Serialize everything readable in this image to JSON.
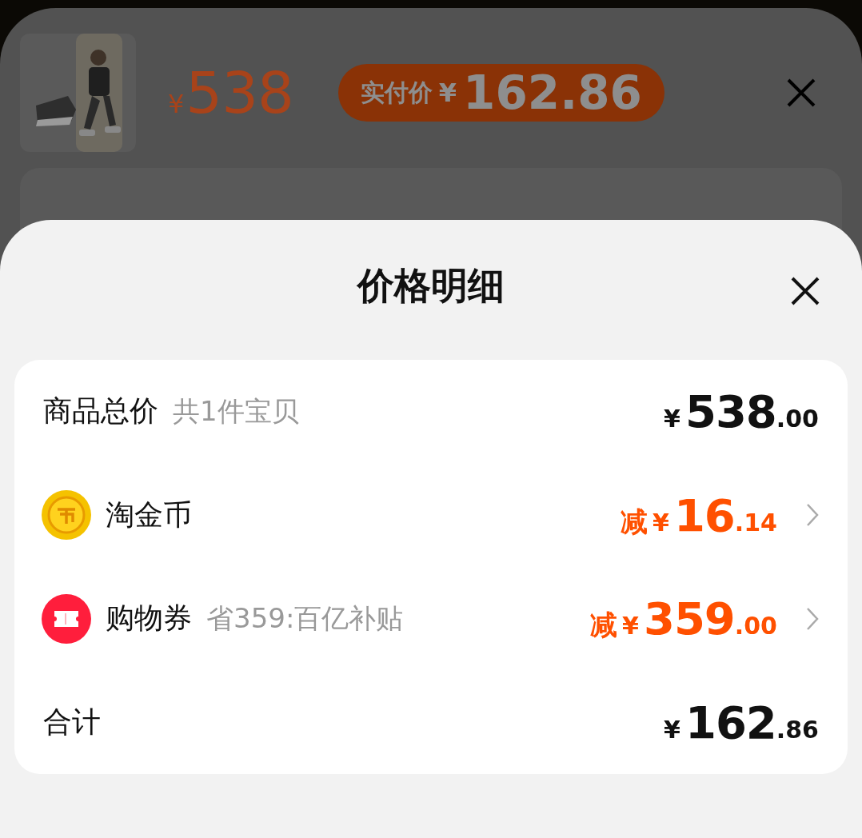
{
  "product_sheet": {
    "price": {
      "currency": "¥",
      "value": "538"
    },
    "paid_badge": {
      "label": "实付价",
      "currency": "¥",
      "value": "162.86"
    }
  },
  "price_detail": {
    "title": "价格明细",
    "rows": [
      {
        "kind": "subtotal",
        "label": "商品总价",
        "note": "共1件宝贝",
        "amount": {
          "currency": "¥",
          "integer": "538",
          "decimal": ".00"
        }
      },
      {
        "kind": "coin",
        "label": "淘金币",
        "amount": {
          "prefix": "减",
          "currency": "¥",
          "integer": "16",
          "decimal": ".14"
        }
      },
      {
        "kind": "coupon",
        "label": "购物券",
        "note": "省359:百亿补贴",
        "amount": {
          "prefix": "减",
          "currency": "¥",
          "integer": "359",
          "decimal": ".00"
        }
      },
      {
        "kind": "total",
        "label": "合计",
        "amount": {
          "currency": "¥",
          "integer": "162",
          "decimal": ".86"
        }
      }
    ]
  }
}
